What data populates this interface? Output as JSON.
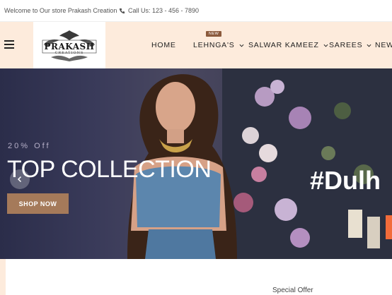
{
  "topbar": {
    "welcome": "Welcome to Our store Prakash Creation",
    "phone": "Call Us: 123 - 456 - 7890"
  },
  "header": {
    "logo_name": "PRAKASH",
    "logo_sub": "CREATIONS",
    "nav": [
      {
        "label": "HOME"
      },
      {
        "label": "LEHNGA'S",
        "badge": "NEW"
      },
      {
        "label": "SALWAR KAMEEZ"
      },
      {
        "label": "SAREES"
      },
      {
        "label": "NEW"
      }
    ]
  },
  "hero": {
    "discount": "20% Off",
    "headline": "TOP COLLECTION",
    "cta": "SHOP NOW",
    "next_slide_text": "#Dulh"
  },
  "section": {
    "special_offer": "Special Offer"
  },
  "colors": {
    "header_bg": "#fdebdc",
    "cta_bg": "#a57a5a",
    "badge_bg": "#8b5a3c",
    "accent_orange": "#f26b3a"
  }
}
